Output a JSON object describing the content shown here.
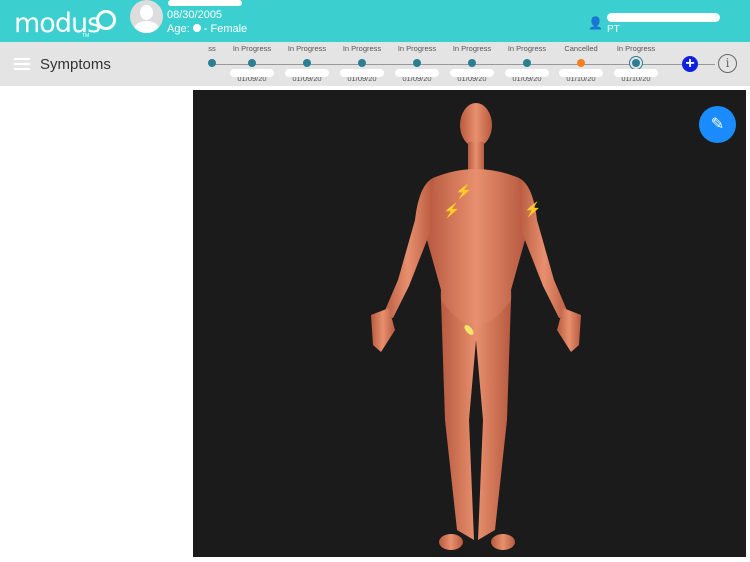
{
  "header": {
    "brand": "modus",
    "trademark": "TM",
    "dob": "08/30/2005",
    "age_label": "Age:",
    "gender": "- Female",
    "provider_role": "PT",
    "provider_icon": "doctor-icon"
  },
  "toolbar": {
    "title": "Symptoms",
    "menu_icon": "hamburger-icon",
    "add_icon": "plus-icon",
    "info_icon": "info-icon"
  },
  "timeline": [
    {
      "status": "ss",
      "date": ""
    },
    {
      "status": "In Progress",
      "date": "01/09/20"
    },
    {
      "status": "In Progress",
      "date": "01/09/20"
    },
    {
      "status": "In Progress",
      "date": "01/09/20"
    },
    {
      "status": "In Progress",
      "date": "01/09/20"
    },
    {
      "status": "In Progress",
      "date": "01/09/20"
    },
    {
      "status": "In Progress",
      "date": "01/09/20"
    },
    {
      "status": "Cancelled",
      "date": "01/10/20"
    },
    {
      "status": "In Progress",
      "date": "01/10/20"
    }
  ],
  "colors": {
    "header": "#3ccfd0",
    "in_progress": "#2a7f93",
    "cancelled": "#f08020",
    "add": "#1020e0",
    "edit": "#1a8cff",
    "skin": "#d9775a",
    "marker": "#f5e66a"
  },
  "viewer": {
    "edit_icon": "pencil-icon",
    "markers": [
      "lightning-icon",
      "lightning-icon",
      "lightning-icon",
      "pain-marker"
    ]
  }
}
